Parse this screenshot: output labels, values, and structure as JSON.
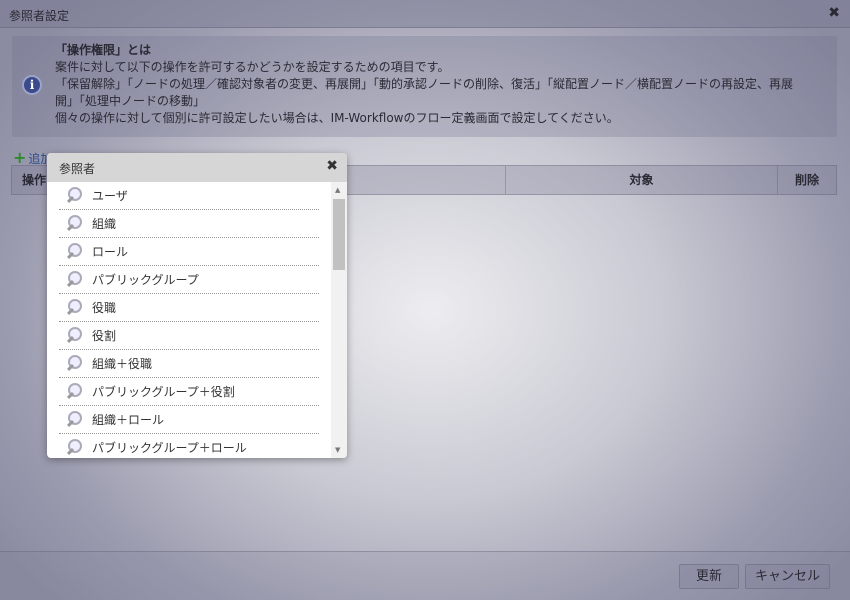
{
  "dialog": {
    "title": "参照者設定",
    "close": "✖"
  },
  "info": {
    "icon": "info-icon",
    "lines": [
      "「操作権限」とは",
      "案件に対して以下の操作を許可するかどうかを設定するための項目です。",
      "「保留解除」「ノードの処理／確認対象者の変更、再展開」「動的承認ノードの削除、復活」「縦配置ノード／横配置ノードの再設定、再展",
      "開」「処理中ノードの移動」",
      "個々の操作に対して個別に許可設定したい場合は、IM-Workflowのフロー定義画面で設定してください。"
    ]
  },
  "add_label": "追加",
  "table": {
    "headers": [
      "操作",
      "対象",
      "削除"
    ]
  },
  "footer": {
    "update": "更新",
    "cancel": "キャンセル"
  },
  "popup": {
    "title": "参照者",
    "close": "✖",
    "items": [
      "ユーザ",
      "組織",
      "ロール",
      "パブリックグループ",
      "役職",
      "役割",
      "組織＋役職",
      "パブリックグループ＋役割",
      "組織＋ロール",
      "パブリックグループ＋ロール"
    ]
  }
}
